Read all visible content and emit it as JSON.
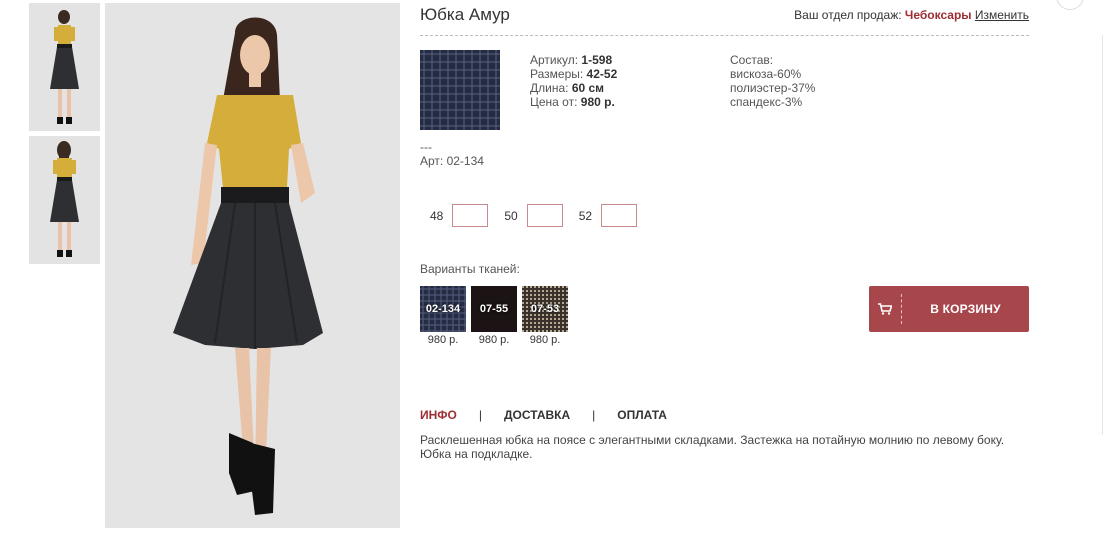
{
  "product": {
    "title": "Юбка Амур",
    "region_label": "Ваш отдел продаж:",
    "region_city": "Чебоксары",
    "region_change": "Изменить"
  },
  "specs": {
    "article_label": "Артикул:",
    "article_value": "1-598",
    "sizes_label": "Размеры:",
    "sizes_value": "42-52",
    "length_label": "Длина:",
    "length_value": "60 см",
    "price_label": "Цена от:",
    "price_value": "980 р."
  },
  "composition": {
    "label": "Состав:",
    "items": [
      "вискоза-60%",
      "полиэстер-37%",
      "спандекс-3%"
    ]
  },
  "fabric": {
    "dash": "---",
    "art": "Арт: 02-134"
  },
  "sizes": [
    {
      "label": "48",
      "value": ""
    },
    {
      "label": "50",
      "value": ""
    },
    {
      "label": "52",
      "value": ""
    }
  ],
  "variants": {
    "label": "Варианты тканей:",
    "items": [
      {
        "code": "02-134",
        "price": "980 р.",
        "color": "#2a3150"
      },
      {
        "code": "07-55",
        "price": "980 р.",
        "color": "#1c1414"
      },
      {
        "code": "07-53",
        "price": "980 р.",
        "color": "#6f6458"
      }
    ]
  },
  "cart": {
    "label": "В КОРЗИНУ",
    "icon": "cart-icon"
  },
  "tabs": [
    {
      "label": "ИНФО",
      "active": true
    },
    {
      "label": "ДОСТАВКА",
      "active": false
    },
    {
      "label": "ОПЛАТА",
      "active": false
    }
  ],
  "tab_separator": "|",
  "description": {
    "line1": "Расклешенная юбка на поясе с элегантными складками. Застежка на потайную молнию по левому боку.",
    "line2": "Юбка на подкладке."
  },
  "colors": {
    "accent": "#9e2d32",
    "button": "#a8474b",
    "blouse": "#d4ad3a",
    "skirt": "#2e2f33"
  }
}
